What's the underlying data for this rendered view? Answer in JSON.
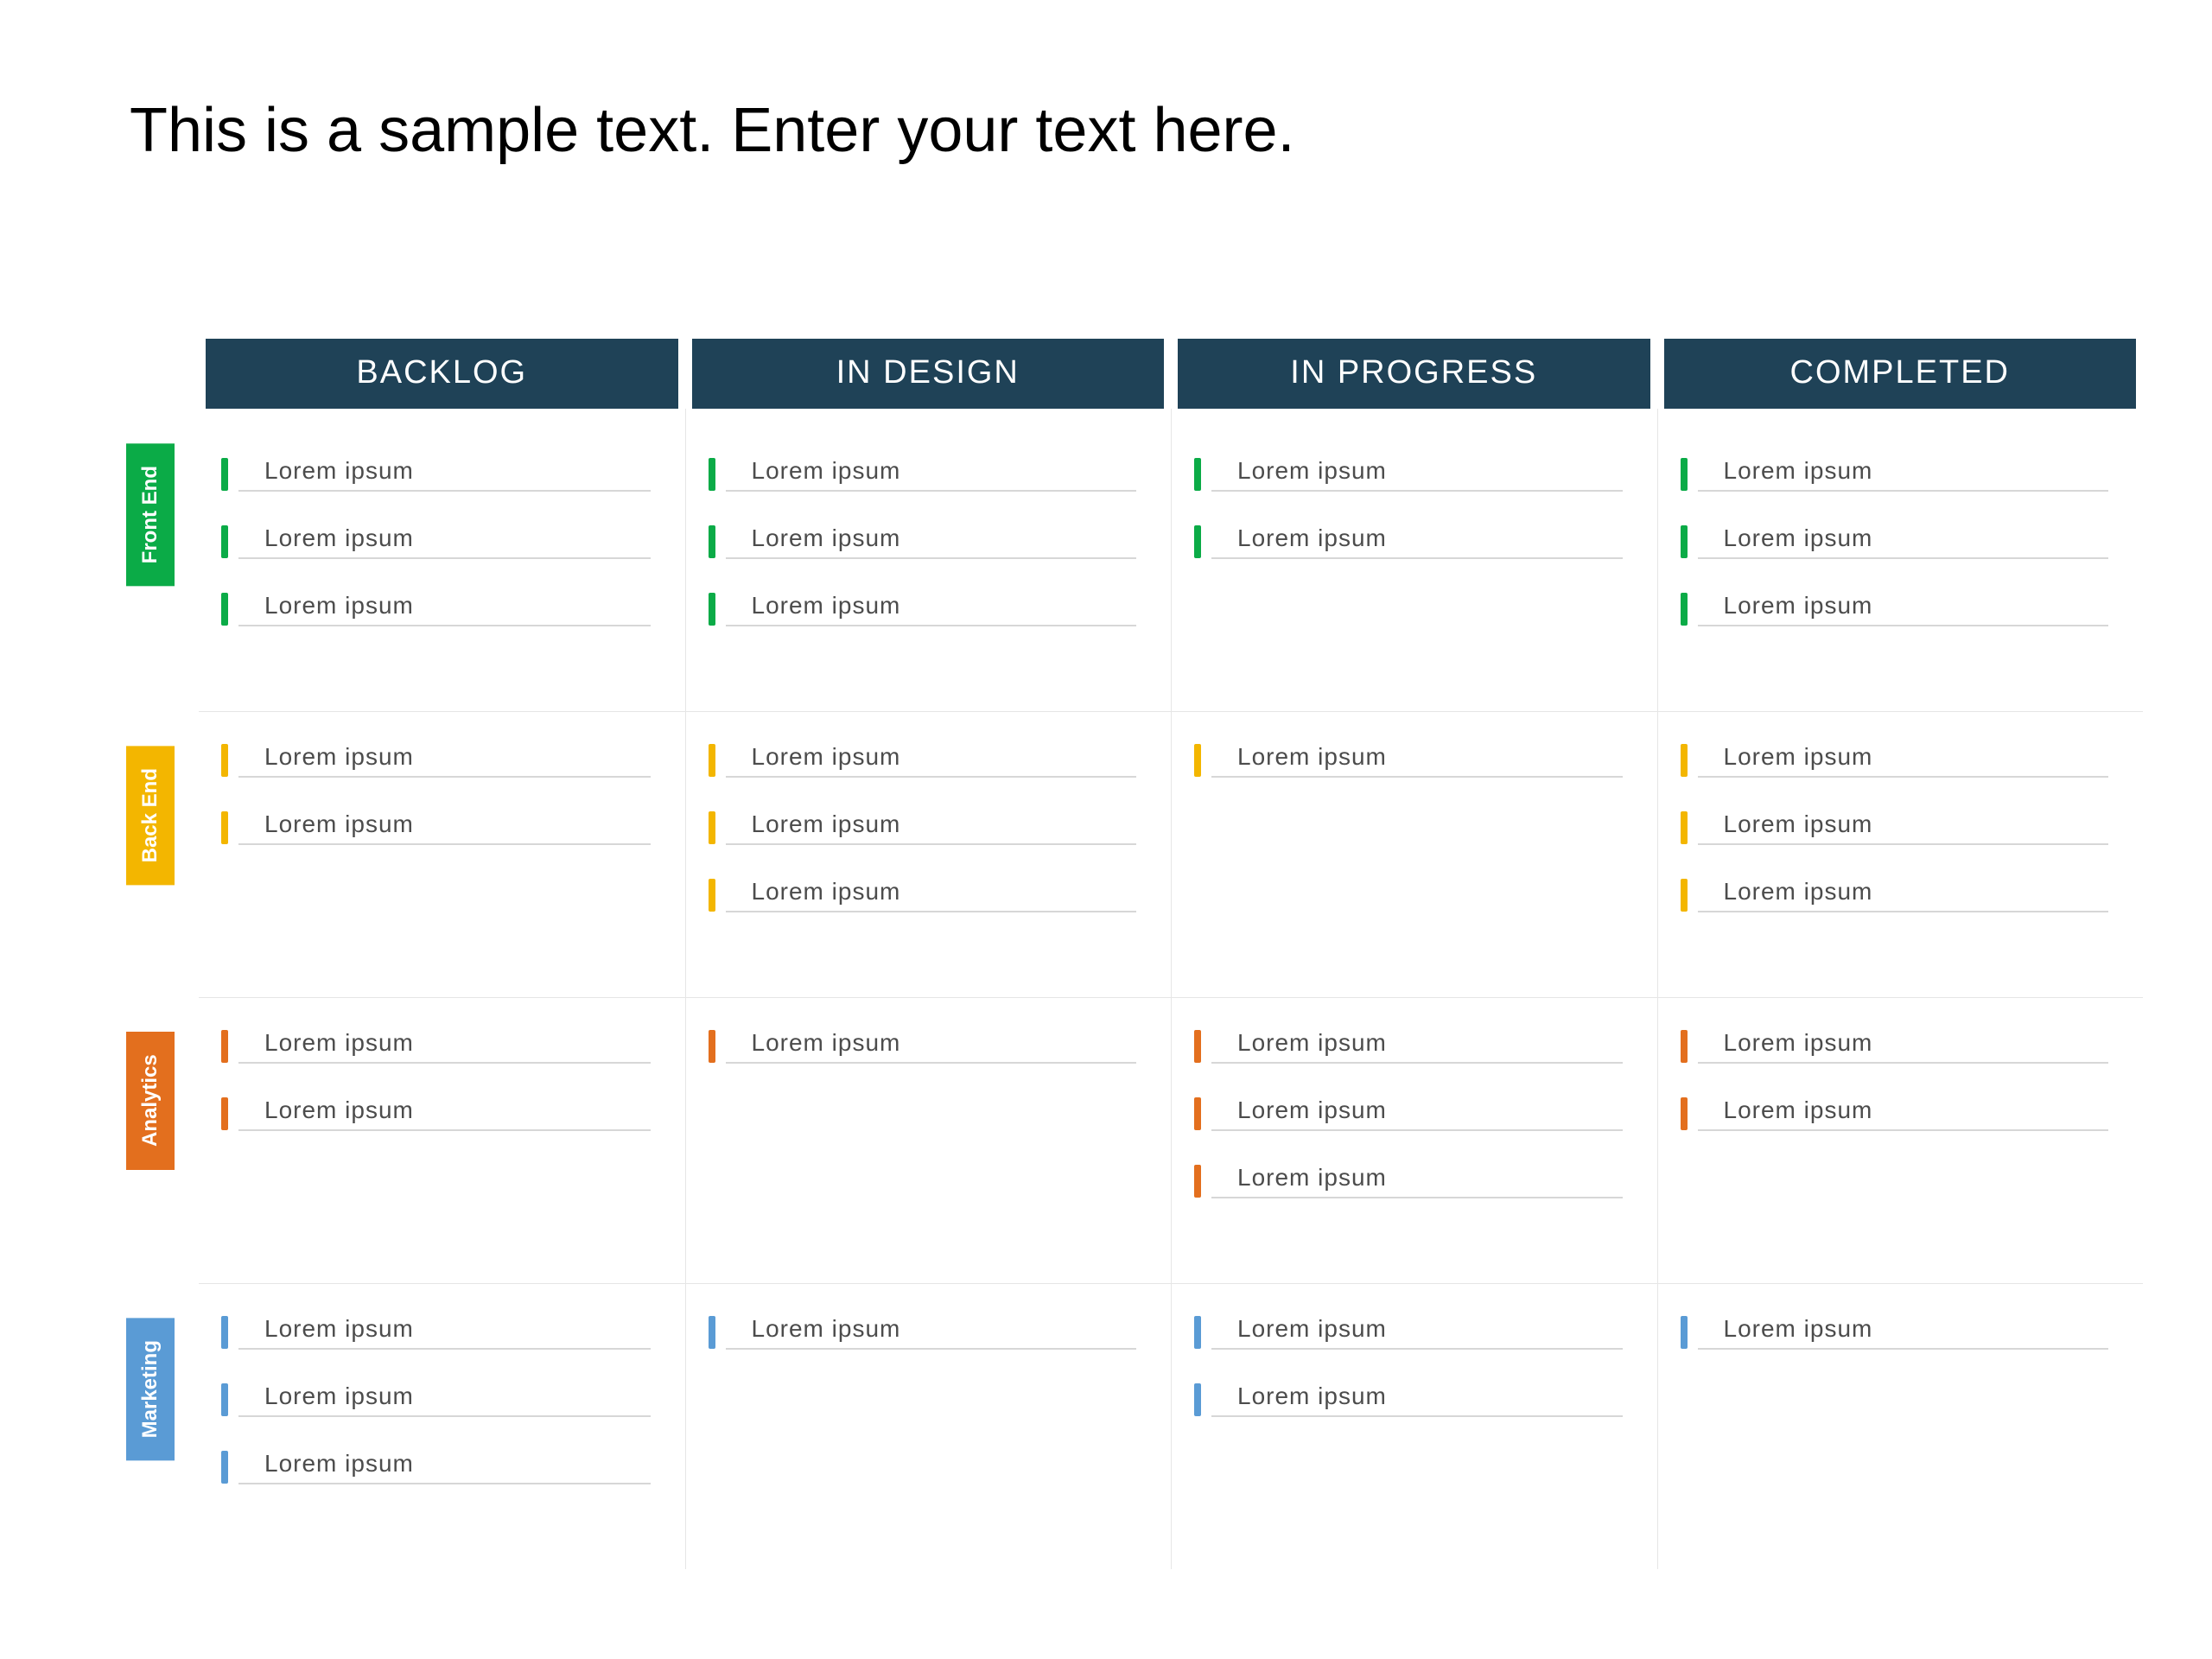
{
  "title": "This is a sample text. Enter your text here.",
  "columns": [
    {
      "label": "BACKLOG"
    },
    {
      "label": "IN DESIGN"
    },
    {
      "label": "IN PROGRESS"
    },
    {
      "label": "COMPLETED"
    }
  ],
  "lanes": [
    {
      "name": "Front End",
      "color": "#0bab47",
      "cells": [
        [
          "Lorem ipsum",
          "Lorem ipsum",
          "Lorem ipsum"
        ],
        [
          "Lorem ipsum",
          "Lorem ipsum",
          "Lorem ipsum"
        ],
        [
          "Lorem ipsum",
          "Lorem ipsum"
        ],
        [
          "Lorem ipsum",
          "Lorem ipsum",
          "Lorem ipsum"
        ]
      ]
    },
    {
      "name": "Back End",
      "color": "#f3b600",
      "cells": [
        [
          "Lorem ipsum",
          "Lorem ipsum"
        ],
        [
          "Lorem ipsum",
          "Lorem ipsum",
          "Lorem ipsum"
        ],
        [
          "Lorem ipsum"
        ],
        [
          "Lorem ipsum",
          "Lorem ipsum",
          "Lorem ipsum"
        ]
      ]
    },
    {
      "name": "Analytics",
      "color": "#e36f1e",
      "cells": [
        [
          "Lorem ipsum",
          "Lorem ipsum"
        ],
        [
          "Lorem ipsum"
        ],
        [
          "Lorem ipsum",
          "Lorem ipsum",
          "Lorem ipsum"
        ],
        [
          "Lorem ipsum",
          "Lorem ipsum"
        ]
      ]
    },
    {
      "name": "Marketing",
      "color": "#5a9bd5",
      "cells": [
        [
          "Lorem ipsum",
          "Lorem ipsum",
          "Lorem ipsum"
        ],
        [
          "Lorem ipsum"
        ],
        [
          "Lorem ipsum",
          "Lorem ipsum"
        ],
        [
          "Lorem ipsum"
        ]
      ]
    }
  ]
}
